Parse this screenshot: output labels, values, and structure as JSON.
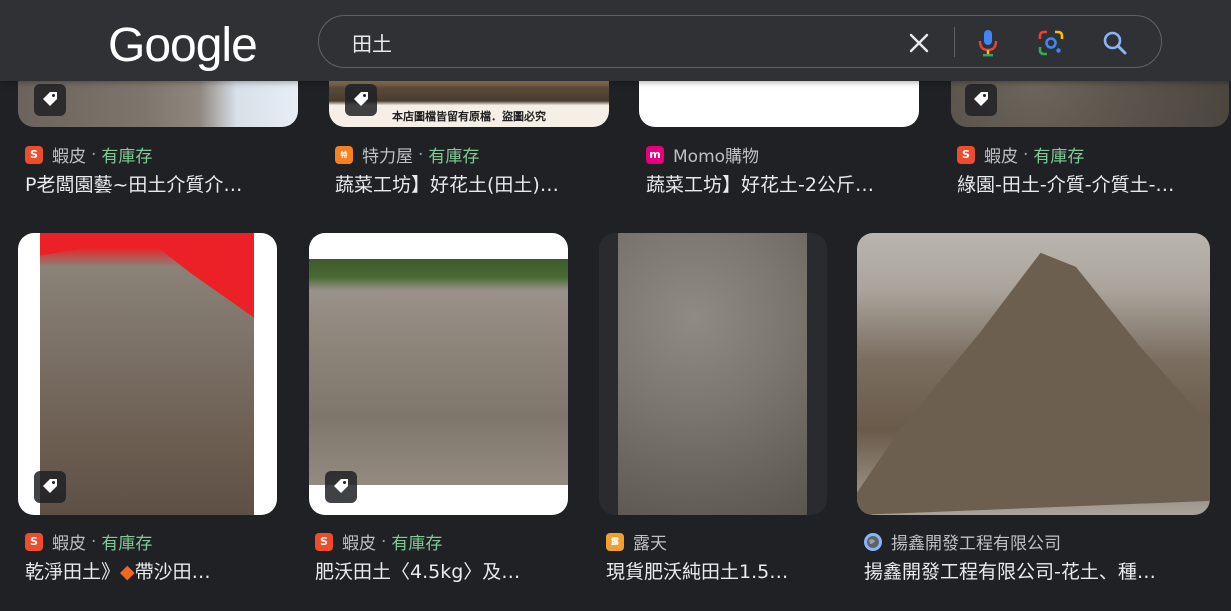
{
  "header": {
    "logo": "Google",
    "search_value": "田土"
  },
  "results": [
    {
      "source": "蝦皮",
      "stock": "有庫存",
      "title": "P老闆園藝~田土介質介…",
      "favicon": "shopee",
      "favicon_color": "#ee4d2d"
    },
    {
      "source": "特力屋",
      "stock": "有庫存",
      "title": "蔬菜工坊】好花土(田土)…",
      "favicon": "trplus",
      "favicon_color": "#f58220",
      "caption": "本店圖檔皆留有原檔．盜圖必究"
    },
    {
      "source": "Momo購物",
      "stock": "",
      "title": "蔬菜工坊】好花土-2公斤…",
      "favicon": "momo",
      "favicon_color": "#e6007e"
    },
    {
      "source": "蝦皮",
      "stock": "有庫存",
      "title": "綠園-田土-介質-介質土-…",
      "favicon": "shopee",
      "favicon_color": "#ee4d2d"
    },
    {
      "source": "蝦皮",
      "stock": "有庫存",
      "title_pre": "乾淨田土》",
      "title_diamond": "◆",
      "title_post": "帶沙田…",
      "favicon": "shopee",
      "favicon_color": "#ee4d2d"
    },
    {
      "source": "蝦皮",
      "stock": "有庫存",
      "title": "肥沃田土〈4.5kg〉及…",
      "favicon": "shopee",
      "favicon_color": "#ee4d2d"
    },
    {
      "source": "露天",
      "stock": "",
      "title": "現貨肥沃純田土1.5…",
      "favicon": "ruten",
      "favicon_color": "#f0a030"
    },
    {
      "source": "揚鑫開發工程有限公司",
      "stock": "",
      "title": "揚鑫開發工程有限公司-花土、種…",
      "favicon": "globe",
      "favicon_color": "#8ab4f8"
    }
  ],
  "separator": "·"
}
